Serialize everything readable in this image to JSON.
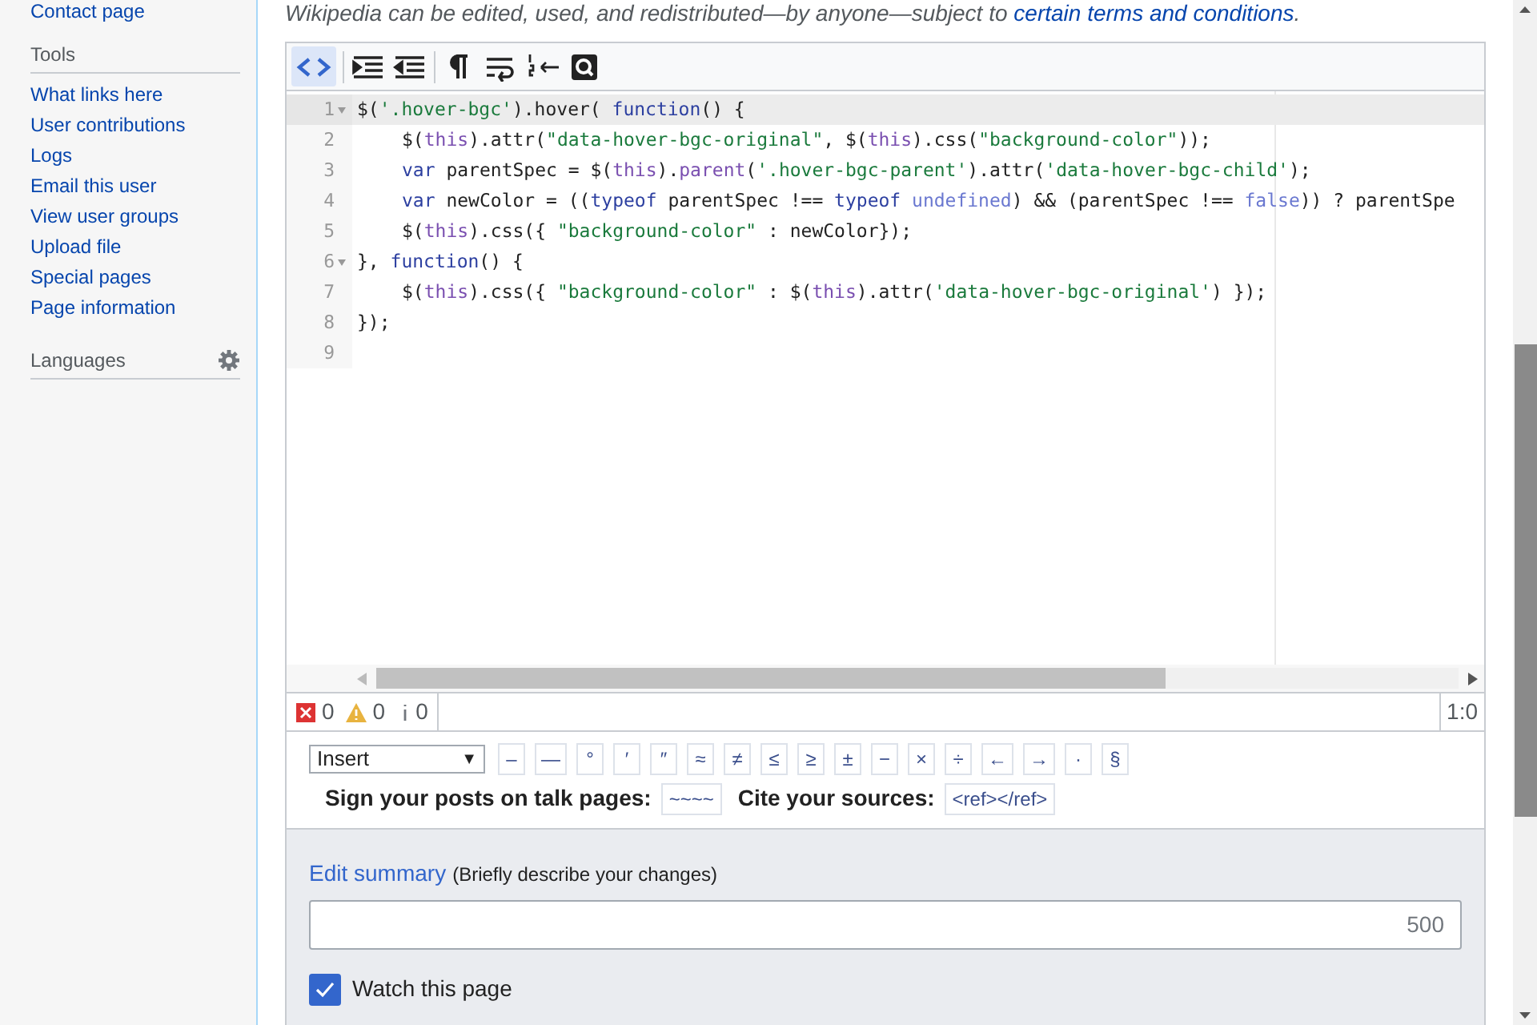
{
  "notice": {
    "text": "Wikipedia can be edited, used, and redistributed—by anyone—subject to ",
    "link": "certain terms and conditions",
    "end": "."
  },
  "sidebar": {
    "top_link": "Contact page",
    "sections": [
      {
        "heading": "Tools",
        "items": [
          "What links here",
          "User contributions",
          "Logs",
          "Email this user",
          "View user groups",
          "Upload file",
          "Special pages",
          "Page information"
        ]
      },
      {
        "heading": "Languages"
      }
    ]
  },
  "toolbar": {
    "syntax_highlight": {
      "selected": true
    }
  },
  "code_lines": [
    {
      "number": "1",
      "foldable": true,
      "active": true,
      "indented": false,
      "tokens": [
        {
          "kind": "plain",
          "text": "$("
        },
        {
          "kind": "string",
          "text": "'.hover-bgc'"
        },
        {
          "kind": "plain",
          "text": ").hover( "
        },
        {
          "kind": "keyword",
          "text": "function"
        },
        {
          "kind": "plain",
          "text": "() {"
        }
      ]
    },
    {
      "number": "2",
      "foldable": false,
      "active": false,
      "indented": true,
      "tokens": [
        {
          "kind": "plain",
          "text": "$("
        },
        {
          "kind": "this",
          "text": "this"
        },
        {
          "kind": "plain",
          "text": ").attr("
        },
        {
          "kind": "string",
          "text": "\"data-hover-bgc-original\""
        },
        {
          "kind": "plain",
          "text": ", $("
        },
        {
          "kind": "this",
          "text": "this"
        },
        {
          "kind": "plain",
          "text": ").css("
        },
        {
          "kind": "string",
          "text": "\"background-color\""
        },
        {
          "kind": "plain",
          "text": "));"
        }
      ]
    },
    {
      "number": "3",
      "foldable": false,
      "active": false,
      "indented": true,
      "tokens": [
        {
          "kind": "keyword",
          "text": "var"
        },
        {
          "kind": "plain",
          "text": " parentSpec = $("
        },
        {
          "kind": "this",
          "text": "this"
        },
        {
          "kind": "plain",
          "text": ")."
        },
        {
          "kind": "this",
          "text": "parent"
        },
        {
          "kind": "plain",
          "text": "("
        },
        {
          "kind": "string",
          "text": "'.hover-bgc-parent'"
        },
        {
          "kind": "plain",
          "text": ").attr("
        },
        {
          "kind": "string",
          "text": "'data-hover-bgc-child'"
        },
        {
          "kind": "plain",
          "text": ");"
        }
      ]
    },
    {
      "number": "4",
      "foldable": false,
      "active": false,
      "indented": true,
      "tokens": [
        {
          "kind": "keyword",
          "text": "var"
        },
        {
          "kind": "plain",
          "text": " newColor = (("
        },
        {
          "kind": "keyword",
          "text": "typeof"
        },
        {
          "kind": "plain",
          "text": " parentSpec !== "
        },
        {
          "kind": "keyword",
          "text": "typeof"
        },
        {
          "kind": "atom",
          "text": " undefined"
        },
        {
          "kind": "plain",
          "text": ") && (parentSpec !== "
        },
        {
          "kind": "atom",
          "text": "false"
        },
        {
          "kind": "plain",
          "text": ")) ? parentSpe"
        }
      ]
    },
    {
      "number": "5",
      "foldable": false,
      "active": false,
      "indented": true,
      "tokens": [
        {
          "kind": "plain",
          "text": "$("
        },
        {
          "kind": "this",
          "text": "this"
        },
        {
          "kind": "plain",
          "text": ").css({ "
        },
        {
          "kind": "string",
          "text": "\"background-color\""
        },
        {
          "kind": "plain",
          "text": " : newColor});"
        }
      ]
    },
    {
      "number": "6",
      "foldable": true,
      "active": false,
      "indented": false,
      "tokens": [
        {
          "kind": "plain",
          "text": "}, "
        },
        {
          "kind": "keyword",
          "text": "function"
        },
        {
          "kind": "plain",
          "text": "() {"
        }
      ]
    },
    {
      "number": "7",
      "foldable": false,
      "active": false,
      "indented": true,
      "tokens": [
        {
          "kind": "plain",
          "text": "$("
        },
        {
          "kind": "this",
          "text": "this"
        },
        {
          "kind": "plain",
          "text": ").css({ "
        },
        {
          "kind": "string",
          "text": "\"background-color\""
        },
        {
          "kind": "plain",
          "text": " : $("
        },
        {
          "kind": "this",
          "text": "this"
        },
        {
          "kind": "plain",
          "text": ").attr("
        },
        {
          "kind": "string",
          "text": "'data-hover-bgc-original'"
        },
        {
          "kind": "plain",
          "text": ") });"
        }
      ]
    },
    {
      "number": "8",
      "foldable": false,
      "active": false,
      "indented": false,
      "tokens": [
        {
          "kind": "plain",
          "text": "});"
        }
      ]
    },
    {
      "number": "9",
      "foldable": false,
      "active": false
    }
  ],
  "status": {
    "errors": "0",
    "warnings": "0",
    "infos": "0",
    "position": "1:0"
  },
  "special_chars": {
    "dropdown": "Insert",
    "dropdown_arrow": "▼",
    "chars": [
      "–",
      "—",
      "°",
      "′",
      "″",
      "≈",
      "≠",
      "≤",
      "≥",
      "±",
      "−",
      "×",
      "÷",
      "←",
      "→",
      "·",
      "§"
    ],
    "sign_label": "Sign your posts on talk pages:",
    "sign_button": "~~~~",
    "cite_label": "Cite your sources:",
    "cite_button": "<ref></ref>"
  },
  "summary": {
    "label": "Edit summary",
    "hint": "(Briefly describe your changes)",
    "counter": "500"
  },
  "watch": {
    "label": "Watch this page",
    "checked": true
  }
}
